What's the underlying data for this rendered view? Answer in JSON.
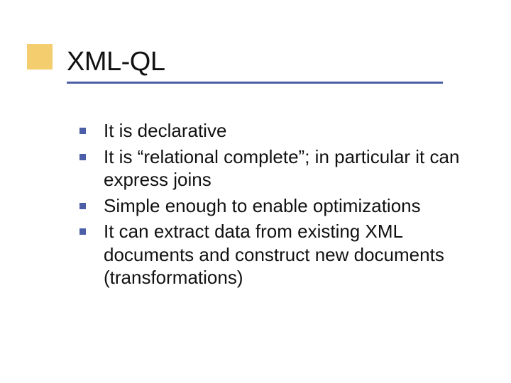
{
  "slide": {
    "title": "XML-QL",
    "bullets": [
      "It is declarative",
      "It is “relational complete”; in particular it can express joins",
      "Simple enough to enable optimizations",
      "It can extract data from existing XML documents and construct new documents (transformations)"
    ]
  }
}
